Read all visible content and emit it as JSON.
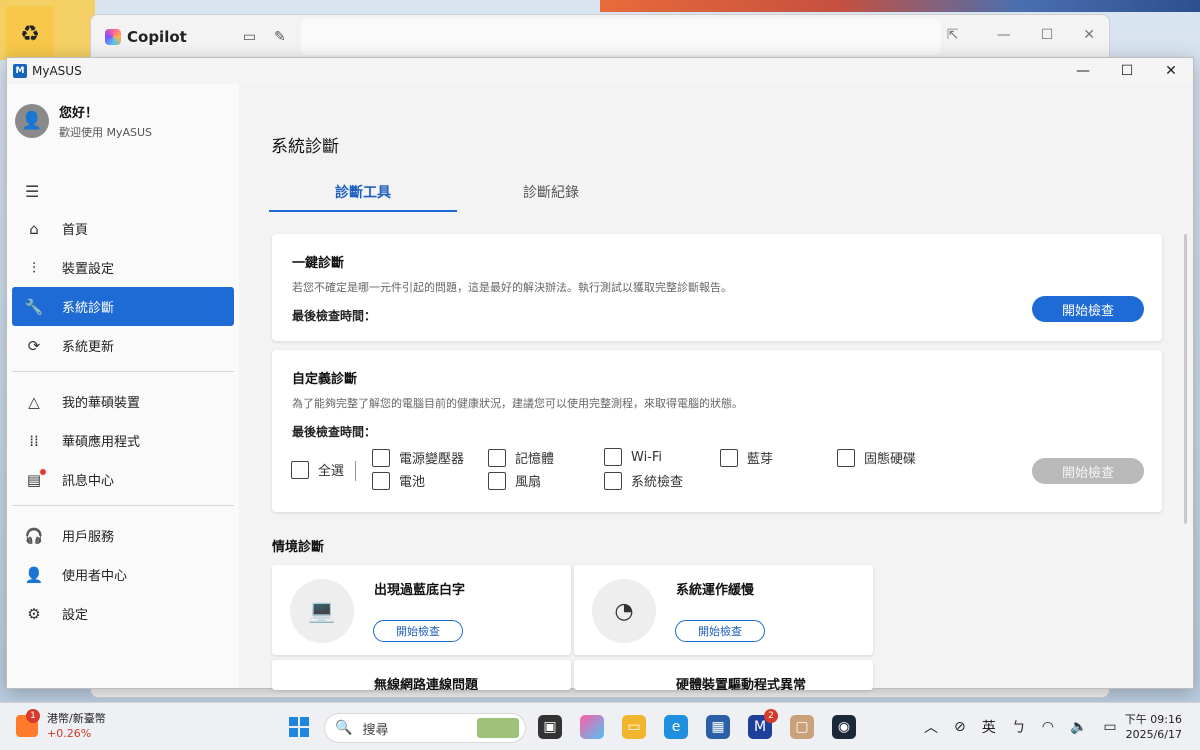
{
  "copilot": {
    "title": "Copilot"
  },
  "window": {
    "title": "MyASUS"
  },
  "user": {
    "greeting": "您好！",
    "welcome": "歡迎使用 MyASUS"
  },
  "nav": {
    "items": [
      {
        "label": "首頁",
        "icon": "home-icon"
      },
      {
        "label": "裝置設定",
        "icon": "sliders-icon"
      },
      {
        "label": "系統診斷",
        "icon": "wrench-icon"
      },
      {
        "label": "系統更新",
        "icon": "update-icon"
      },
      {
        "label": "我的華碩裝置",
        "icon": "device-icon"
      },
      {
        "label": "華碩應用程式",
        "icon": "apps-grid-icon"
      },
      {
        "label": "訊息中心",
        "icon": "message-icon"
      },
      {
        "label": "用戶服務",
        "icon": "headset-icon"
      },
      {
        "label": "使用者中心",
        "icon": "person-icon"
      },
      {
        "label": "設定",
        "icon": "gear-icon"
      }
    ]
  },
  "page": {
    "title": "系統診斷",
    "tabs": [
      "診斷工具",
      "診斷紀錄"
    ]
  },
  "one_click": {
    "title": "一鍵診斷",
    "desc": "若您不確定是哪一元件引起的問題，這是最好的解決辦法。執行測試以獲取完整診斷報告。",
    "last_check": "最後檢查時間：",
    "button": "開始檢查"
  },
  "custom": {
    "title": "自定義診斷",
    "desc": "為了能夠完整了解您的電腦目前的健康狀況，建議您可以使用完整測程，來取得電腦的狀態。",
    "last_check": "最後檢查時間：",
    "select_all": "全選",
    "options": [
      "電源變壓器",
      "記憶體",
      "Wi-Fi",
      "藍芽",
      "固態硬碟",
      "電池",
      "風扇",
      "系統檢查"
    ],
    "button": "開始檢查"
  },
  "scenario": {
    "title": "情境診斷",
    "cards": [
      {
        "title": "出現過藍底白字",
        "button": "開始檢查",
        "icon": "laptop-sad-icon"
      },
      {
        "title": "系統運作緩慢",
        "button": "開始檢查",
        "icon": "speedometer-icon"
      },
      {
        "title": "無線網路連線問題",
        "icon": "wifi-icon"
      },
      {
        "title": "硬體裝置驅動程式異常",
        "icon": "driver-icon"
      }
    ]
  },
  "taskbar": {
    "ticker_name": "港幣/新臺幣",
    "ticker_change": "+0.26%",
    "ticker_badge": "1",
    "search_placeholder": "搜尋",
    "myasus_badge": "2",
    "ime": "英",
    "time": "下午 09:16",
    "date": "2025/6/17"
  },
  "colors": {
    "accent": "#1e6bd6",
    "disabled": "#b9b9b9"
  }
}
